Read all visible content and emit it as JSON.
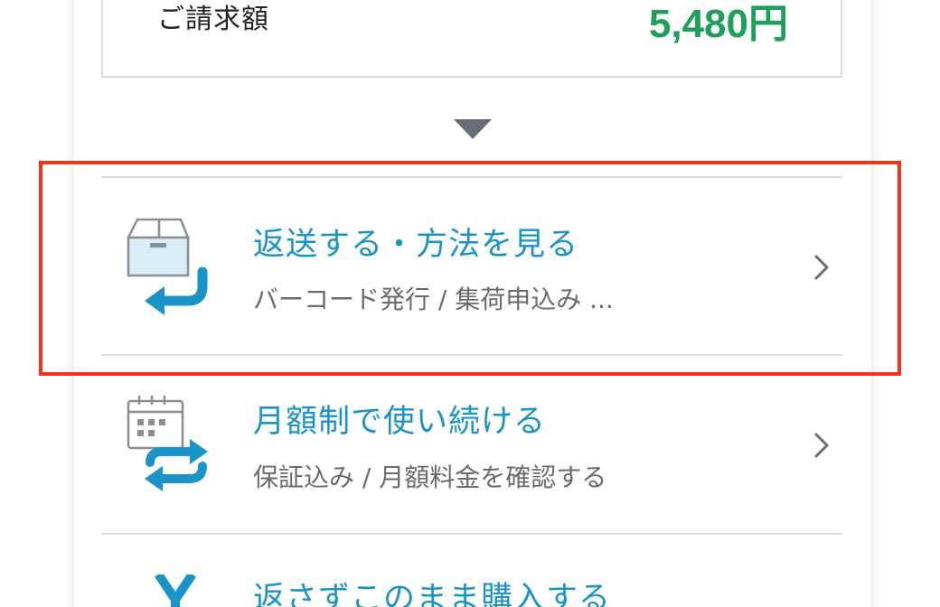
{
  "billing": {
    "label": "ご請求額",
    "amount": "5,480円"
  },
  "expand_icon": "triangle-down-icon",
  "menu": [
    {
      "title": "返送する・方法を見る",
      "subtitle": "バーコード発行 / 集荷申込み ...",
      "icon": "box-return-icon"
    },
    {
      "title": "月額制で使い続ける",
      "subtitle": "保証込み / 月額料金を確認する",
      "icon": "calendar-repeat-icon"
    },
    {
      "title": "返さずこのまま購入する",
      "subtitle": "",
      "icon": "yen-icon"
    }
  ],
  "colors": {
    "accent_blue": "#1a93c8",
    "amount_green": "#1fa05a",
    "highlight_red": "#f5321a",
    "icon_blue": "#1a93c8"
  }
}
